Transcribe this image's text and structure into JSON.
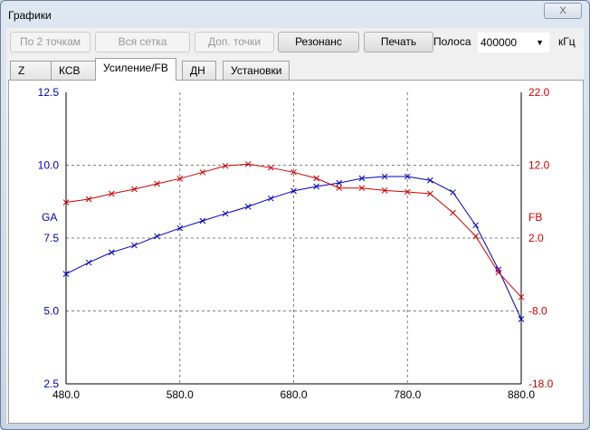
{
  "window": {
    "title": "Графики",
    "close_label": "X"
  },
  "toolbar": {
    "btn_2pts": "По 2 точкам",
    "btn_grid": "Вся сетка",
    "btn_extra": "Доп. точки",
    "btn_resonance": "Резонанс",
    "btn_print": "Печать",
    "band_label": "Полоса",
    "band_value": "400000",
    "unit": "кГц"
  },
  "tabs": [
    {
      "label": "Z"
    },
    {
      "label": "КСВ"
    },
    {
      "label": "Усиление/FB"
    },
    {
      "label": "ДН"
    },
    {
      "label": "Установки"
    }
  ],
  "chart_data": {
    "type": "line",
    "xlabel": "",
    "ylabel": "GA",
    "y2label": "FB",
    "xlim": [
      480,
      880
    ],
    "ylim": [
      2.5,
      12.5
    ],
    "y2lim": [
      -18,
      22
    ],
    "xticks": [
      "480.0",
      "580.0",
      "680.0",
      "780.0",
      "880.0"
    ],
    "yticks": [
      "12.5",
      "10.0",
      "7.5",
      "5.0",
      "2.5"
    ],
    "y2ticks": [
      "22.0",
      "12.0",
      "2.0",
      "-8.0",
      "-18.0"
    ],
    "grid": true,
    "x": [
      480,
      500,
      520,
      540,
      560,
      580,
      600,
      620,
      640,
      660,
      680,
      700,
      720,
      740,
      760,
      780,
      800,
      820,
      840,
      860,
      880
    ],
    "series": [
      {
        "name": "GA",
        "axis": "left",
        "color": "#0000c0",
        "values": [
          6.27,
          6.66,
          7.01,
          7.25,
          7.56,
          7.84,
          8.09,
          8.34,
          8.58,
          8.86,
          9.12,
          9.27,
          9.39,
          9.55,
          9.61,
          9.61,
          9.48,
          9.07,
          7.94,
          6.42,
          4.72
        ]
      },
      {
        "name": "FB",
        "axis": "right",
        "color": "#d00000",
        "values": [
          6.9,
          7.34,
          8.09,
          8.71,
          9.45,
          10.16,
          11.03,
          11.9,
          12.15,
          11.65,
          11.03,
          10.2,
          8.87,
          8.87,
          8.54,
          8.33,
          8.09,
          5.48,
          2.25,
          -2.72,
          -6.1
        ]
      }
    ]
  }
}
